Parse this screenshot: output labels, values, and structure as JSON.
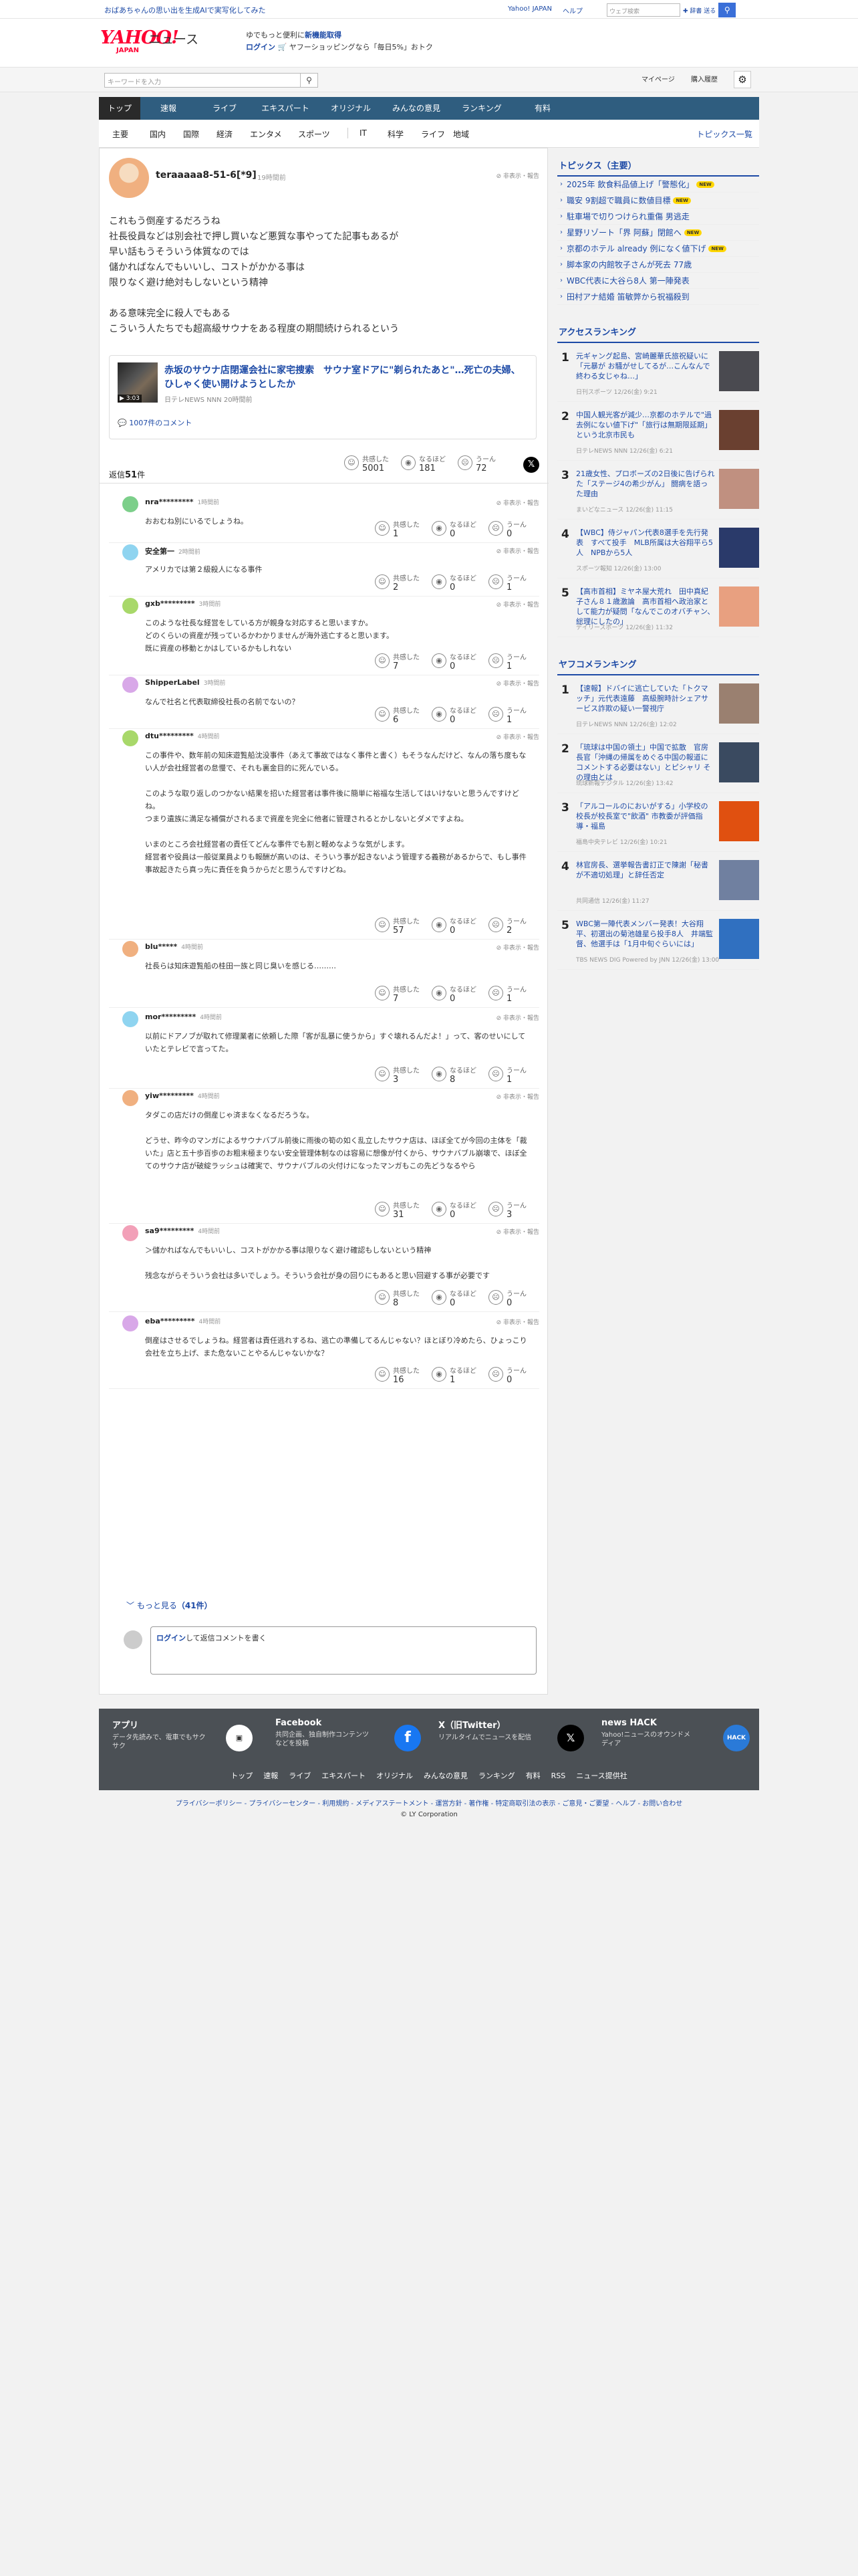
{
  "topbar": {
    "promo": "おばあちゃんの思い出を生成AIで実写化してみた",
    "links": [
      "Yahoo! JAPAN",
      "ヘルプ"
    ],
    "web_search_placeholder": "ウェブ検索",
    "search_label": "✚ 辞書 送る"
  },
  "header": {
    "logo_text": "YAHOO!",
    "logo_sub": "JAPAN",
    "news_word": "ニュース",
    "promo_line1": "ゆでもっと便利に",
    "promo_line1_bold": "新機能取得",
    "promo_login": "ログイン",
    "promo_line2": "🛒 ヤフーショッピングなら「毎日5%」おトク"
  },
  "subbar": {
    "search_placeholder": "キーワードを入力",
    "mypage": "マイページ",
    "history": "購入履歴"
  },
  "global_nav": [
    "トップ",
    "速報",
    "ライブ",
    "エキスパート",
    "オリジナル",
    "みんなの意見",
    "ランキング",
    "有料"
  ],
  "category_nav": [
    "主要",
    "国内",
    "国際",
    "経済",
    "エンタメ",
    "スポーツ",
    "IT",
    "科学",
    "ライフ",
    "地域"
  ],
  "category_all": "トピックス一覧",
  "parent_comment": {
    "user": "teraaaaa8-51-6[*9]",
    "time": "19時間前",
    "hide_label": "非表示・報告",
    "body": "これもう倒産するだろうね\n社長役員などは別会社で押し買いなど悪質な事やってた記事もあるが\n早い話もうそういう体質なのでは\n儲かればなんでもいいし、コストがかかる事は\n限りなく避け絶対もしないという精神\n\nある意味完全に殺人でもある\nこういう人たちでも超高級サウナをある程度の期間続けられるという",
    "reactions": [
      {
        "label": "共感した",
        "count": "5001"
      },
      {
        "label": "なるほど",
        "count": "181"
      },
      {
        "label": "うーん",
        "count": "72"
      }
    ]
  },
  "article": {
    "title": "赤坂のサウナ店閉運会社に家宅捜索　サウナ室ドアに\"剃られたあと\"…死亡の夫婦、ひしゃく使い開けようとしたか",
    "source": "日テレNEWS NNN 20時間前",
    "duration": "▶ 3:03",
    "comments": "1007件のコメント"
  },
  "reply_count_label": "返信",
  "reply_count": "51",
  "reply_count_unit": "件",
  "replies": [
    {
      "user": "nra*********",
      "time": "1時間前",
      "body": "おおむね別にいるでしょうね。",
      "reactions": [
        "1",
        "0",
        "0"
      ],
      "color": "#7ccf8a"
    },
    {
      "user": "安全第一",
      "time": "2時間前",
      "body": "アメリカでは第２級殺人になる事件",
      "reactions": [
        "2",
        "0",
        "1"
      ],
      "color": "#8fd4f0"
    },
    {
      "user": "gxb*********",
      "time": "3時間前",
      "body": "このような社長な経営をしている方が親身な対応すると思いますか。\nどのくらいの資産が残っているかわかりませんが海外逃亡すると思います。\n既に資産の移動とかはしているかもしれない",
      "reactions": [
        "7",
        "0",
        "1"
      ],
      "color": "#a8d86a"
    },
    {
      "user": "ShipperLabel",
      "time": "3時間前",
      "body": "なんで社名と代表取締役社長の名前でないの？",
      "reactions": [
        "6",
        "0",
        "1"
      ],
      "color": "#d8a8e8"
    },
    {
      "user": "dtu*********",
      "time": "4時間前",
      "body": "この事件や、数年前の知床遊覧船沈没事件（あえて事故ではなく事件と書く）もそうなんだけど、なんの落ち度もない人が会社経営者の怠慢で、それも裏金目的に死んでいる。\n\nこのような取り返しのつかない結果を招いた経営者は事件後に簡単に裕福な生活してはいけないと思うんですけどね。\nつまり遺族に満足な補償がされるまで資産を完全に他者に管理されるとかしないとダメですよね。\n\nいまのところ会社経営者の責任てどんな事件でも割と軽めなような気がします。\n経営者や役員は一般従業員よりも報酬が高いのは、そういう事が起きないよう管理する義務があるからで、もし事件事故起きたら真っ先に責任を負うからだと思うんですけどね。",
      "reactions": [
        "57",
        "0",
        "2"
      ],
      "color": "#a8d86a"
    },
    {
      "user": "blu*****",
      "time": "4時間前",
      "body": "社長らは知床遊覧船の桂田一族と同じ臭いを感じる………",
      "reactions": [
        "7",
        "0",
        "1"
      ],
      "color": "#f0b080"
    },
    {
      "user": "mor*********",
      "time": "4時間前",
      "body": "以前にドアノブが取れて修理業者に依頼した際「客が乱暴に使うから」すぐ壊れるんだよ！」って、客のせいにしていたとテレビで言ってた。",
      "reactions": [
        "3",
        "8",
        "1"
      ],
      "color": "#8fd4f0"
    },
    {
      "user": "yiw*********",
      "time": "4時間前",
      "body": "タダこの店だけの倒産じゃ済まなくなるだろうな。\n\nどうせ、昨今のマンガによるサウナバブル前後に雨後の筍の如く乱立したサウナ店は、ほぼ全てが今回の主体を「裁いた」店と五十歩百歩のお粗末極まりない安全管理体制なのは容易に想像が付くから、サウナバブル崩壊で、ほぼ全てのサウナ店が破綻ラッシュは確実で、サウナバブルの火付けになったマンガもこの先どうなるやら",
      "reactions": [
        "31",
        "0",
        "3"
      ],
      "color": "#f0b080"
    },
    {
      "user": "sa9*********",
      "time": "4時間前",
      "body": "＞儲かればなんでもいいし、コストがかかる事は限りなく避け確認もしないという精神\n\n残念ながらそういう会社は多いでしょう。そういう会社が身の回りにもあると思い回避する事が必要です",
      "reactions": [
        "8",
        "0",
        "0"
      ],
      "color": "#f2a0b8"
    },
    {
      "user": "eba*********",
      "time": "4時間前",
      "body": "倒産はさせるでしょうね。経営者は責任逃れするね、逃亡の準備してるんじゃない？ほとぼり冷めたら、ひょっこり会社を立ち上げ、また危ないことやるんじゃないかな？",
      "reactions": [
        "16",
        "1",
        "0"
      ],
      "color": "#d8a8e8"
    }
  ],
  "more_label": "もっと見る",
  "more_count": "（41件）",
  "comment_form": {
    "login": "ログイン",
    "text": "して返信コメントを書く"
  },
  "sidebar": {
    "topics_title": "トピックス（主要）",
    "topics": [
      {
        "text": "2025年 飲食料品値上げ「警態化」",
        "new": true
      },
      {
        "text": "職安 9割超で職員に数値目標",
        "new": true
      },
      {
        "text": "駐車場で切りつけられ重傷 男逃走",
        "new": false
      },
      {
        "text": "星野リゾート「界 阿蘇」閉館へ",
        "new": true
      },
      {
        "text": "京都のホテル already 例になく値下げ",
        "new": true
      },
      {
        "text": "脚本家の内館牧子さんが死去 77歳",
        "new": false
      },
      {
        "text": "WBC代表に大谷ら8人 第一陣発表",
        "new": false
      },
      {
        "text": "田村アナ結婚 笛敏弊から祝福殺到",
        "new": false
      }
    ],
    "new_badge": "NEW",
    "access_title": "アクセスランキング",
    "access": [
      {
        "rank": "1",
        "title": "元ギャング起島、宮崎麗華氏旅祝疑いに「元暴が お騒がせしてるが…こんなんで終わる女じゃね…」",
        "source": "日刊スポーツ 12/26(金) 9:21",
        "img": "#4a4a50"
      },
      {
        "rank": "2",
        "title": "中国人観光客が減少…京都のホテルで\"過去例にない値下げ\"「旅行は無期限延期」という北京市民も",
        "source": "日テレNEWS NNN 12/26(金) 6:21",
        "img": "#6a4030"
      },
      {
        "rank": "3",
        "title": "21歳女性、プロボーズの2日後に告げられた「ステージ4の希少がん」 闘病を語った理由",
        "source": "まいどなニュース 12/26(金) 11:15",
        "img": "#c09080"
      },
      {
        "rank": "4",
        "title": "【WBC】侍ジャパン代表8選手を先行発表　すべて投手　MLB所属は大谷翔平ら5人　NPBから5人",
        "source": "スポーツ報知 12/26(金) 13:00",
        "img": "#2a3a6a"
      },
      {
        "rank": "5",
        "title": "【高市首相】ミヤネ屋大荒れ　田中真紀子さん８１歳激論　高市首相へ政治家として能力が疑問「なんでこのオバチャン、総理にしたの」",
        "source": "デイリースポーツ 12/26(金) 11:32",
        "img": "#e8a080"
      }
    ],
    "yahoo_title": "ヤフコメランキング",
    "yahoo": [
      {
        "rank": "1",
        "title": "【速報】ドバイに逃亡していた「トクマッチ」元代表遠藤　高級腕時計シェアサービス詐欺の疑い一警視庁",
        "source": "日テレNEWS NNN 12/26(金) 12:02",
        "img": "#9a8070"
      },
      {
        "rank": "2",
        "title": "「琉球は中国の領土」中国で拡散　官房長官「沖縄の帰属をめぐる中国の報道にコメントする必要はない」とピシャリ その理由とは",
        "source": "琉球新報デジタル 12/26(金) 13:42",
        "img": "#3a4a60"
      },
      {
        "rank": "3",
        "title": "「アルコールのにおいがする」小学校の校長が校長室で\"飲酒\" 市教委が評価指導・福島",
        "source": "福島中央テレビ 12/26(金) 10:21",
        "img": "#e05010"
      },
      {
        "rank": "4",
        "title": "林官房長、選挙報告書訂正で陳謝「秘書が不適切処理」と辞任否定",
        "source": "共同通信 12/26(金) 11:27",
        "img": "#7080a0"
      },
      {
        "rank": "5",
        "title": "WBC第一陣代表メンバー発表！大谷翔平、初選出の菊池雄星ら投手8人　井端監督、他選手は「1月中旬ぐらいには」",
        "source": "TBS NEWS DIG Powered by JNN 12/26(金) 13:00",
        "img": "#3070c0"
      }
    ]
  },
  "footer": {
    "cards": [
      {
        "title": "アプリ",
        "desc": "データ先読みで、電車でもサクサク"
      },
      {
        "title": "Facebook",
        "desc": "共同企画、独自制作コンテンツなどを投稿"
      },
      {
        "title": "X（旧Twitter）",
        "desc": "リアルタイムでニュースを配信"
      },
      {
        "title": "news HACK",
        "desc": "Yahoo!ニュースのオウンドメディア"
      }
    ],
    "nav": [
      "トップ",
      "速報",
      "ライブ",
      "エキスパート",
      "オリジナル",
      "みんなの意見",
      "ランキング",
      "有料",
      "RSS",
      "ニュース提供社"
    ],
    "legal": "プライバシーポリシー - プライバシーセンター - 利用規約 - メディアステートメント - 運営方針 - 著作権 - 特定商取引法の表示 - ご意見・ご要望 - ヘルプ - お問い合わせ",
    "copyright": "© LY Corporation"
  },
  "colors": {
    "brand_red": "#ff0033",
    "nav_blue": "#2f5d7f",
    "link_blue": "#1d4aa6",
    "new_yellow": "#ffd600",
    "footer_bg": "#4b5055"
  }
}
